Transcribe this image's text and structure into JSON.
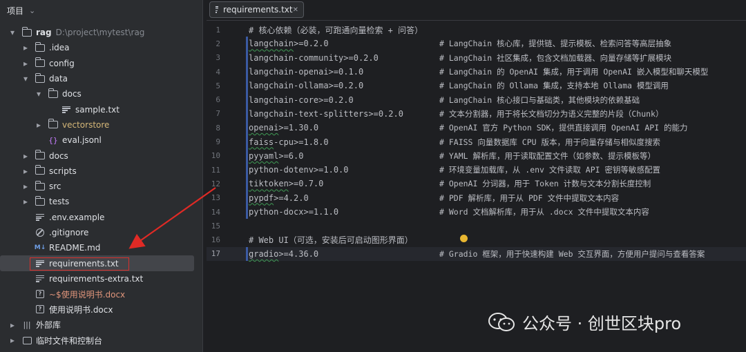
{
  "sidebar": {
    "title": "项目",
    "tree": [
      {
        "label": "rag",
        "extra": "D:\\project\\mytest\\rag",
        "icon": "folder-icon",
        "arrow": "open",
        "depth": 0
      },
      {
        "label": ".idea",
        "icon": "folder-icon",
        "arrow": "closed",
        "depth": 1
      },
      {
        "label": "config",
        "icon": "folder-icon",
        "arrow": "closed",
        "depth": 1
      },
      {
        "label": "data",
        "icon": "folder-icon",
        "arrow": "open",
        "depth": 1
      },
      {
        "label": "docs",
        "icon": "folder-icon",
        "arrow": "open",
        "depth": 2
      },
      {
        "label": "sample.txt",
        "icon": "text-file-icon",
        "arrow": "none",
        "depth": 3
      },
      {
        "label": "vectorstore",
        "icon": "folder-icon",
        "arrow": "closed",
        "depth": 2,
        "color": "gold"
      },
      {
        "label": "eval.jsonl",
        "icon": "json-file-icon",
        "arrow": "none",
        "depth": 2
      },
      {
        "label": "docs",
        "icon": "folder-icon",
        "arrow": "closed",
        "depth": 1
      },
      {
        "label": "scripts",
        "icon": "folder-icon",
        "arrow": "closed",
        "depth": 1
      },
      {
        "label": "src",
        "icon": "folder-icon",
        "arrow": "closed",
        "depth": 1
      },
      {
        "label": "tests",
        "icon": "folder-icon",
        "arrow": "closed",
        "depth": 1
      },
      {
        "label": ".env.example",
        "icon": "text-file-icon",
        "arrow": "none",
        "depth": 1
      },
      {
        "label": ".gitignore",
        "icon": "gitignore-icon",
        "arrow": "none",
        "depth": 1
      },
      {
        "label": "README.md",
        "icon": "markdown-icon",
        "arrow": "none",
        "depth": 1
      },
      {
        "label": "requirements.txt",
        "icon": "text-file-icon",
        "arrow": "none",
        "depth": 1,
        "selected": true
      },
      {
        "label": "requirements-extra.txt",
        "icon": "text-file-icon",
        "arrow": "none",
        "depth": 1
      },
      {
        "label": "~$使用说明书.docx",
        "icon": "unknown-file-icon",
        "arrow": "none",
        "depth": 1,
        "color": "orange"
      },
      {
        "label": "使用说明书.docx",
        "icon": "unknown-file-icon",
        "arrow": "none",
        "depth": 1
      },
      {
        "label": "外部库",
        "icon": "library-icon",
        "arrow": "closed",
        "depth": 0
      },
      {
        "label": "临时文件和控制台",
        "icon": "scratch-icon",
        "arrow": "closed",
        "depth": 0
      }
    ]
  },
  "editor": {
    "tab_label": "requirements.txt",
    "current_line": 17,
    "lines": [
      {
        "n": "1",
        "code": "# 核心依赖（必装，可跑通向量检索 + 问答）",
        "comment": "",
        "bar": false
      },
      {
        "n": "2",
        "code": "langchain>=0.2.0",
        "comment": "# LangChain 核心库，提供链、提示模板、检索问答等高层抽象",
        "bar": true,
        "wavy": "langchain"
      },
      {
        "n": "3",
        "code": "langchain-community>=0.2.0",
        "comment": "# LangChain 社区集成，包含文档加载器、向量存储等扩展模块",
        "bar": true
      },
      {
        "n": "4",
        "code": "langchain-openai>=0.1.0",
        "comment": "# LangChain 的 OpenAI 集成，用于调用 OpenAI 嵌入模型和聊天模型",
        "bar": true
      },
      {
        "n": "5",
        "code": "langchain-ollama>=0.2.0",
        "comment": "# LangChain 的 Ollama 集成，支持本地 Ollama 模型调用",
        "bar": true
      },
      {
        "n": "6",
        "code": "langchain-core>=0.2.0",
        "comment": "# LangChain 核心接口与基础类，其他模块的依赖基础",
        "bar": true
      },
      {
        "n": "7",
        "code": "langchain-text-splitters>=0.2.0",
        "comment": "# 文本分割器，用于将长文档切分为语义完整的片段（Chunk）",
        "bar": true
      },
      {
        "n": "8",
        "code": "openai>=1.30.0",
        "comment": "# OpenAI 官方 Python SDK，提供直接调用 OpenAI API 的能力",
        "bar": true,
        "wavy": "openai"
      },
      {
        "n": "9",
        "code": "faiss-cpu>=1.8.0",
        "comment": "# FAISS 向量数据库 CPU 版本，用于向量存储与相似度搜索",
        "bar": true,
        "wavy": "faiss"
      },
      {
        "n": "10",
        "code": "pyyaml>=6.0",
        "comment": "# YAML 解析库，用于读取配置文件（如参数、提示模板等）",
        "bar": true,
        "wavy": "pyyaml"
      },
      {
        "n": "11",
        "code": "python-dotenv>=1.0.0",
        "comment": "# 环境变量加载库，从 .env 文件读取 API 密钥等敏感配置",
        "bar": true
      },
      {
        "n": "12",
        "code": "tiktoken>=0.7.0",
        "comment": "# OpenAI 分词器，用于 Token 计数与文本分割长度控制",
        "bar": true,
        "wavy": "tiktoken"
      },
      {
        "n": "13",
        "code": "pypdf>=4.2.0",
        "comment": "# PDF 解析库，用于从 PDF 文件中提取文本内容",
        "bar": true,
        "wavy": "pypdf"
      },
      {
        "n": "14",
        "code": "python-docx>=1.1.0",
        "comment": "# Word 文档解析库，用于从 .docx 文件中提取文本内容",
        "bar": true
      },
      {
        "n": "15",
        "code": "",
        "comment": "",
        "bar": false
      },
      {
        "n": "16",
        "code": "# Web UI（可选，安装后可启动图形界面）",
        "comment": "",
        "bar": false
      },
      {
        "n": "17",
        "code": "gradio>=4.36.0",
        "comment": "# Gradio 框架，用于快速构建 Web 交互界面，方便用户提问与查看答案",
        "bar": true,
        "wavy": "gradio"
      }
    ]
  },
  "watermark": {
    "text": "公众号 · 创世区块pro"
  },
  "colors": {
    "background": "#1e1f22",
    "sidebar": "#2b2d30",
    "change_bar": "#3b5aa3",
    "highlight_outline": "#d9302c",
    "arrow": "#e02a25"
  }
}
